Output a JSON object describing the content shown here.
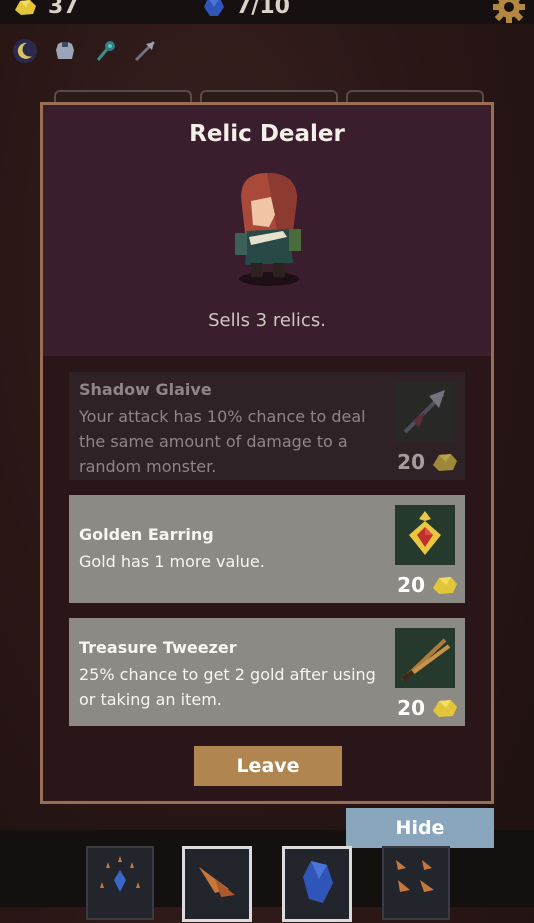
{
  "hud": {
    "gold_count": "37",
    "gem_count": "7/10",
    "status_icons": [
      "moon-icon",
      "armor-icon",
      "mace-icon",
      "glaive-icon"
    ]
  },
  "dialog": {
    "title": "Relic Dealer",
    "subtitle": "Sells 3 relics.",
    "relics": [
      {
        "name": "Shadow Glaive",
        "description": "Your attack has 10% chance to deal the same amount of damage to a random monster.",
        "price": "20",
        "icon": "shadow-glaive-icon",
        "state": "unavailable"
      },
      {
        "name": "Golden Earring",
        "description": "Gold has 1 more value.",
        "price": "20",
        "icon": "golden-earring-icon",
        "state": "available"
      },
      {
        "name": "Treasure Tweezer",
        "description": "25% chance to get 2 gold after using or taking an item.",
        "price": "20",
        "icon": "treasure-tweezer-icon",
        "state": "available"
      }
    ],
    "leave_label": "Leave"
  },
  "hide_label": "Hide",
  "inventory": [
    "gem-spikes-card",
    "claws-card",
    "blue-gem-card",
    "claws-card"
  ],
  "colors": {
    "panel_border": "#9a6e55",
    "panel_header": "#3b1e2d",
    "relic_available_bg": "#8b8a85",
    "leave_button": "#b08550",
    "hide_button": "#8aa6bd",
    "gold": "#e3c53a"
  }
}
